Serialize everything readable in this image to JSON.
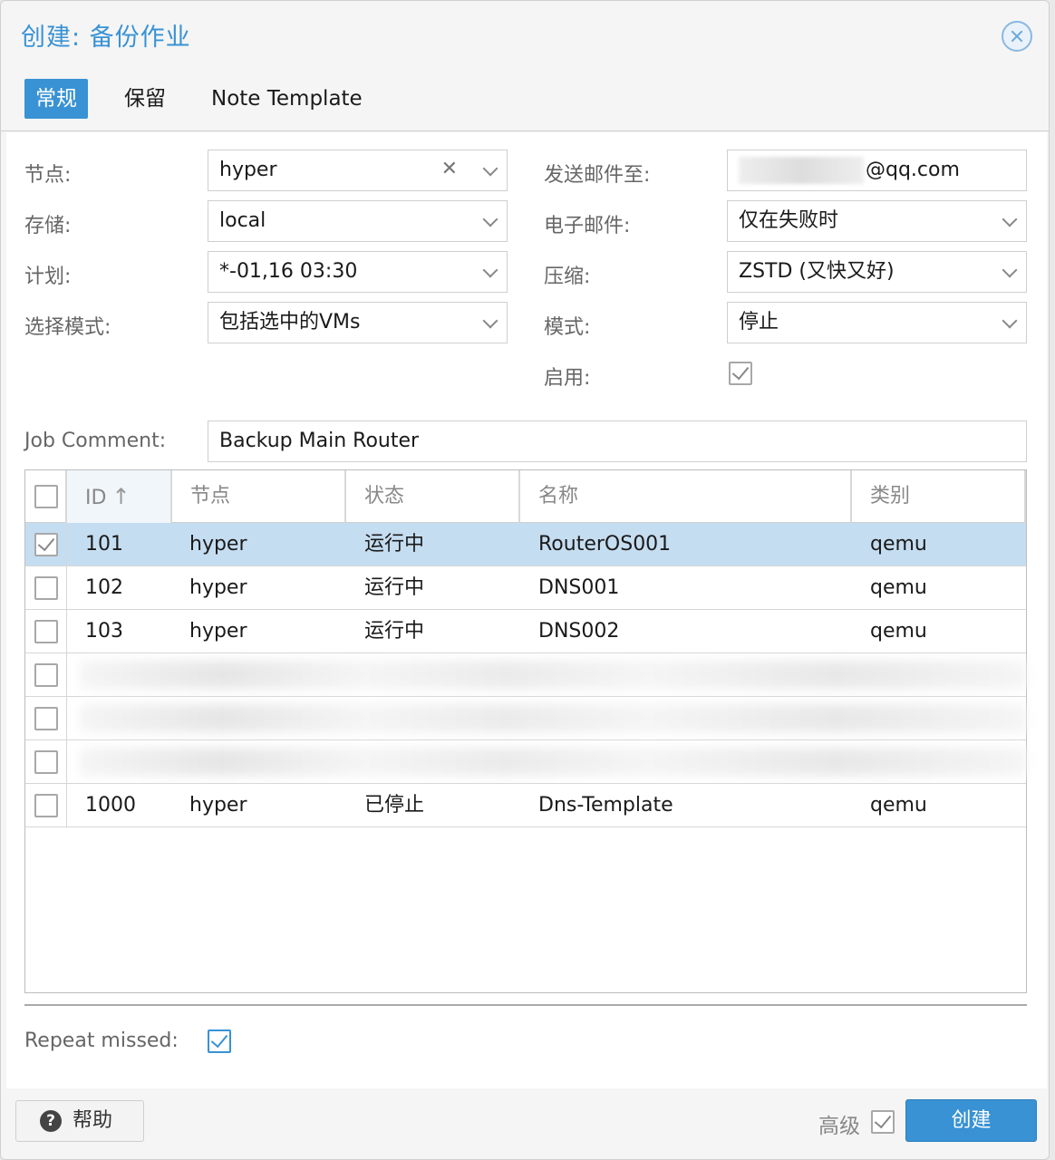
{
  "dialog": {
    "title": "创建: 备份作业"
  },
  "tabs": [
    {
      "label": "常规",
      "active": true
    },
    {
      "label": "保留",
      "active": false
    },
    {
      "label": "Note Template",
      "active": false
    }
  ],
  "form": {
    "node": {
      "label": "节点:",
      "value": "hyper"
    },
    "storage": {
      "label": "存储:",
      "value": "local"
    },
    "schedule": {
      "label": "计划:",
      "value": "*-01,16 03:30"
    },
    "selection_mode": {
      "label": "选择模式:",
      "value": "包括选中的VMs"
    },
    "send_email_to": {
      "label": "发送邮件至:",
      "value": "@qq.com"
    },
    "email": {
      "label": "电子邮件:",
      "value": "仅在失败时"
    },
    "compression": {
      "label": "压缩:",
      "value": "ZSTD (又快又好)"
    },
    "mode": {
      "label": "模式:",
      "value": "停止"
    },
    "enable": {
      "label": "启用:",
      "checked": true
    },
    "job_comment": {
      "label": "Job Comment:",
      "value": "Backup Main Router"
    },
    "repeat_missed": {
      "label": "Repeat missed:",
      "checked": true
    }
  },
  "grid": {
    "columns": [
      "ID",
      "节点",
      "状态",
      "名称",
      "类别"
    ],
    "sort_indicator": "↑",
    "rows": [
      {
        "id": "101",
        "node": "hyper",
        "status": "运行中",
        "name": "RouterOS001",
        "type": "qemu",
        "checked": true
      },
      {
        "id": "102",
        "node": "hyper",
        "status": "运行中",
        "name": "DNS001",
        "type": "qemu",
        "checked": false
      },
      {
        "id": "103",
        "node": "hyper",
        "status": "运行中",
        "name": "DNS002",
        "type": "qemu",
        "checked": false
      },
      {
        "id": "1000",
        "node": "hyper",
        "status": "已停止",
        "name": "Dns-Template",
        "type": "qemu",
        "checked": false
      }
    ]
  },
  "footer": {
    "help_label": "帮助",
    "help_icon_glyph": "?",
    "advanced_label": "高级",
    "advanced_checked": true,
    "create_label": "创建"
  },
  "colors": {
    "accent": "#3892d4",
    "selected_row": "#c5ddf1"
  }
}
